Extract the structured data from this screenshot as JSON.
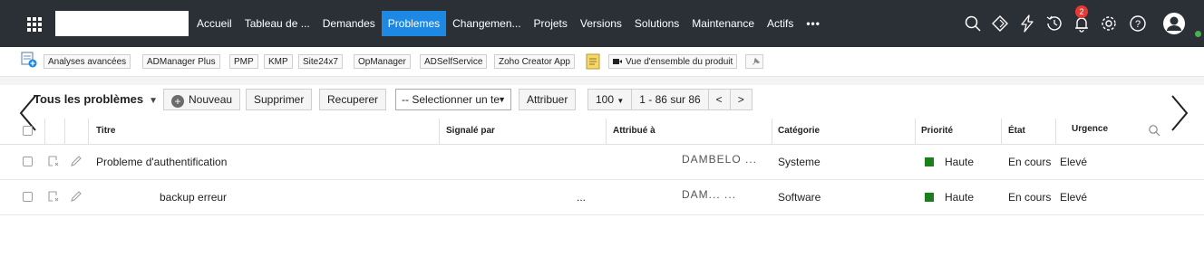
{
  "nav": {
    "items": [
      "Accueil",
      "Tableau de ...",
      "Demandes",
      "Problemes",
      "Changemen...",
      "Projets",
      "Versions",
      "Solutions",
      "Maintenance",
      "Actifs"
    ],
    "active_index": 3,
    "more": "•••",
    "notification_count": "2",
    "icons": [
      "search-icon",
      "diamond-icon",
      "lightning-icon",
      "history-icon",
      "bell-icon",
      "gear-icon",
      "help-icon",
      "user-avatar-icon"
    ]
  },
  "toolbar": {
    "buttons": [
      "Analyses avancées",
      "ADManager Plus",
      "PMP",
      "KMP",
      "Site24x7",
      "OpManager",
      "ADSelfService",
      "Zoho Creator App",
      "Vue d'ensemble du produit"
    ]
  },
  "actions": {
    "view_title": "Tous les problèmes",
    "new_label": "Nouveau",
    "delete_label": "Supprimer",
    "recover_label": "Recuperer",
    "select_value": "-- Selectionner un te",
    "assign_label": "Attribuer",
    "page_size": "100",
    "range": "1 - 86 sur 86",
    "prev": "<",
    "next": ">"
  },
  "table": {
    "columns": [
      "Titre",
      "Signalé par",
      "Attribué à",
      "Catégorie",
      "Priorité",
      "État",
      "Urgence"
    ],
    "rows": [
      {
        "title": "Probleme d'authentification",
        "reported": "",
        "assigned": "DAMBELO ...",
        "category": "Systeme",
        "priority": "Haute",
        "state": "En cours",
        "urgency": "Elevé"
      },
      {
        "title": "backup erreur",
        "reported": "...",
        "assigned": "DAM... ...",
        "category": "Software",
        "priority": "Haute",
        "state": "En cours",
        "urgency": "Elevé"
      }
    ]
  },
  "colors": {
    "nav_bg": "#2b2f36",
    "active_tab": "#1e88e5",
    "priority_high": "#1b7f1b",
    "badge": "#e53935"
  }
}
